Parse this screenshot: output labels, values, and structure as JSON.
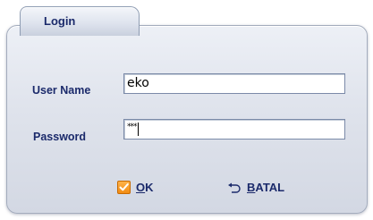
{
  "dialog": {
    "tab_title": "Login",
    "username": {
      "label": "User Name",
      "value": "eko"
    },
    "password": {
      "label": "Password",
      "masked_value": "***"
    },
    "buttons": {
      "ok": {
        "mnemonic": "O",
        "rest": "K",
        "icon": "check-icon"
      },
      "cancel": {
        "mnemonic": "B",
        "rest": "ATAL",
        "icon": "undo-icon"
      }
    }
  },
  "colors": {
    "label_text": "#1b2a6b",
    "panel_top": "#edf0f6",
    "panel_bottom": "#d3d8e3",
    "ok_icon": "#f28b12"
  }
}
